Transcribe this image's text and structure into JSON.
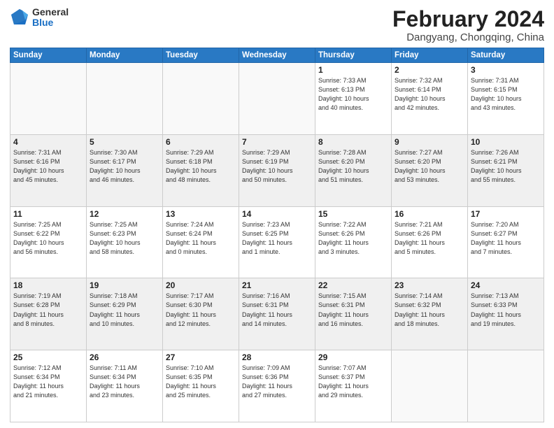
{
  "logo": {
    "general": "General",
    "blue": "Blue"
  },
  "title": {
    "month_year": "February 2024",
    "location": "Dangyang, Chongqing, China"
  },
  "days_of_week": [
    "Sunday",
    "Monday",
    "Tuesday",
    "Wednesday",
    "Thursday",
    "Friday",
    "Saturday"
  ],
  "weeks": [
    {
      "shaded": false,
      "days": [
        {
          "num": "",
          "info": ""
        },
        {
          "num": "",
          "info": ""
        },
        {
          "num": "",
          "info": ""
        },
        {
          "num": "",
          "info": ""
        },
        {
          "num": "1",
          "info": "Sunrise: 7:33 AM\nSunset: 6:13 PM\nDaylight: 10 hours\nand 40 minutes."
        },
        {
          "num": "2",
          "info": "Sunrise: 7:32 AM\nSunset: 6:14 PM\nDaylight: 10 hours\nand 42 minutes."
        },
        {
          "num": "3",
          "info": "Sunrise: 7:31 AM\nSunset: 6:15 PM\nDaylight: 10 hours\nand 43 minutes."
        }
      ]
    },
    {
      "shaded": true,
      "days": [
        {
          "num": "4",
          "info": "Sunrise: 7:31 AM\nSunset: 6:16 PM\nDaylight: 10 hours\nand 45 minutes."
        },
        {
          "num": "5",
          "info": "Sunrise: 7:30 AM\nSunset: 6:17 PM\nDaylight: 10 hours\nand 46 minutes."
        },
        {
          "num": "6",
          "info": "Sunrise: 7:29 AM\nSunset: 6:18 PM\nDaylight: 10 hours\nand 48 minutes."
        },
        {
          "num": "7",
          "info": "Sunrise: 7:29 AM\nSunset: 6:19 PM\nDaylight: 10 hours\nand 50 minutes."
        },
        {
          "num": "8",
          "info": "Sunrise: 7:28 AM\nSunset: 6:20 PM\nDaylight: 10 hours\nand 51 minutes."
        },
        {
          "num": "9",
          "info": "Sunrise: 7:27 AM\nSunset: 6:20 PM\nDaylight: 10 hours\nand 53 minutes."
        },
        {
          "num": "10",
          "info": "Sunrise: 7:26 AM\nSunset: 6:21 PM\nDaylight: 10 hours\nand 55 minutes."
        }
      ]
    },
    {
      "shaded": false,
      "days": [
        {
          "num": "11",
          "info": "Sunrise: 7:25 AM\nSunset: 6:22 PM\nDaylight: 10 hours\nand 56 minutes."
        },
        {
          "num": "12",
          "info": "Sunrise: 7:25 AM\nSunset: 6:23 PM\nDaylight: 10 hours\nand 58 minutes."
        },
        {
          "num": "13",
          "info": "Sunrise: 7:24 AM\nSunset: 6:24 PM\nDaylight: 11 hours\nand 0 minutes."
        },
        {
          "num": "14",
          "info": "Sunrise: 7:23 AM\nSunset: 6:25 PM\nDaylight: 11 hours\nand 1 minute."
        },
        {
          "num": "15",
          "info": "Sunrise: 7:22 AM\nSunset: 6:26 PM\nDaylight: 11 hours\nand 3 minutes."
        },
        {
          "num": "16",
          "info": "Sunrise: 7:21 AM\nSunset: 6:26 PM\nDaylight: 11 hours\nand 5 minutes."
        },
        {
          "num": "17",
          "info": "Sunrise: 7:20 AM\nSunset: 6:27 PM\nDaylight: 11 hours\nand 7 minutes."
        }
      ]
    },
    {
      "shaded": true,
      "days": [
        {
          "num": "18",
          "info": "Sunrise: 7:19 AM\nSunset: 6:28 PM\nDaylight: 11 hours\nand 8 minutes."
        },
        {
          "num": "19",
          "info": "Sunrise: 7:18 AM\nSunset: 6:29 PM\nDaylight: 11 hours\nand 10 minutes."
        },
        {
          "num": "20",
          "info": "Sunrise: 7:17 AM\nSunset: 6:30 PM\nDaylight: 11 hours\nand 12 minutes."
        },
        {
          "num": "21",
          "info": "Sunrise: 7:16 AM\nSunset: 6:31 PM\nDaylight: 11 hours\nand 14 minutes."
        },
        {
          "num": "22",
          "info": "Sunrise: 7:15 AM\nSunset: 6:31 PM\nDaylight: 11 hours\nand 16 minutes."
        },
        {
          "num": "23",
          "info": "Sunrise: 7:14 AM\nSunset: 6:32 PM\nDaylight: 11 hours\nand 18 minutes."
        },
        {
          "num": "24",
          "info": "Sunrise: 7:13 AM\nSunset: 6:33 PM\nDaylight: 11 hours\nand 19 minutes."
        }
      ]
    },
    {
      "shaded": false,
      "days": [
        {
          "num": "25",
          "info": "Sunrise: 7:12 AM\nSunset: 6:34 PM\nDaylight: 11 hours\nand 21 minutes."
        },
        {
          "num": "26",
          "info": "Sunrise: 7:11 AM\nSunset: 6:34 PM\nDaylight: 11 hours\nand 23 minutes."
        },
        {
          "num": "27",
          "info": "Sunrise: 7:10 AM\nSunset: 6:35 PM\nDaylight: 11 hours\nand 25 minutes."
        },
        {
          "num": "28",
          "info": "Sunrise: 7:09 AM\nSunset: 6:36 PM\nDaylight: 11 hours\nand 27 minutes."
        },
        {
          "num": "29",
          "info": "Sunrise: 7:07 AM\nSunset: 6:37 PM\nDaylight: 11 hours\nand 29 minutes."
        },
        {
          "num": "",
          "info": ""
        },
        {
          "num": "",
          "info": ""
        }
      ]
    }
  ]
}
